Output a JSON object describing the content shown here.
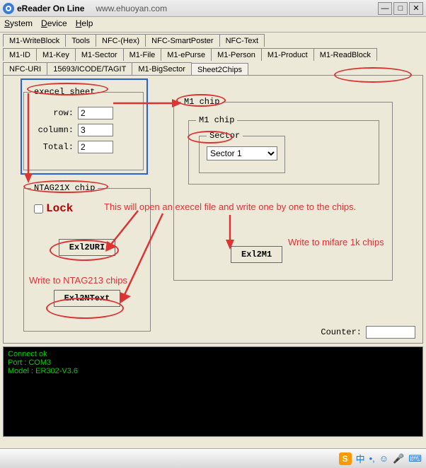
{
  "window": {
    "title": "eReader On Line",
    "url": "www.ehuoyan.com"
  },
  "menu": {
    "system": "System",
    "device": "Device",
    "help": "Help"
  },
  "tabs_row1": [
    "M1-WriteBlock",
    "Tools",
    "NFC-(Hex)",
    "NFC-SmartPoster",
    "NFC-Text"
  ],
  "tabs_row2": [
    "M1-ID",
    "M1-Key",
    "M1-Sector",
    "M1-File",
    "M1-ePurse",
    "M1-Person",
    "M1-Product",
    "M1-ReadBlock"
  ],
  "tabs_row3": [
    "NFC-URI",
    "15693/ICODE/TAGIT",
    "M1-BigSector",
    "Sheet2Chips"
  ],
  "active_tab": "Sheet2Chips",
  "excel": {
    "legend": "execel sheet",
    "row_label": "row:",
    "row_value": "2",
    "col_label": "column:",
    "col_value": "3",
    "total_label": "Total:",
    "total_value": "2"
  },
  "ntag": {
    "legend": "NTAG21X chip",
    "lock_label": "Lock",
    "btn_uri": "Exl2URI",
    "btn_ntext": "Exl2NText"
  },
  "m1": {
    "legend": "M1 chip",
    "inner_legend": "M1 chip",
    "sector_legend": "Sector",
    "sector_options": [
      "Sector 1"
    ],
    "sector_value": "Sector 1",
    "btn_m1": "Exl2M1"
  },
  "counter_label": "Counter:",
  "counter_value": "",
  "console": {
    "line1": "Connect ok",
    "line2": "Port : COM3",
    "line3": "Model : ER302-V3.6"
  },
  "annotations": {
    "note_open": "This will open an execel file and write one by one to the chips.",
    "note_mifare": "Write to mifare 1k chips",
    "note_ntag": "Write to NTAG213 chips"
  },
  "tray": {
    "s": "S",
    "i1": "中",
    "i2": "•,",
    "i3": "☺",
    "i4": "🎤",
    "i5": "⌨"
  }
}
